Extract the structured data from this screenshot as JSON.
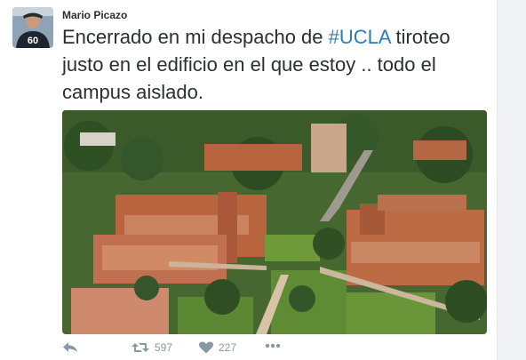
{
  "user": {
    "name": "Mario Picazo",
    "avatar_shirt_number": "60"
  },
  "tweet": {
    "text_before": "Encerrado en mi despacho de ",
    "hashtag": "#UCLA",
    "text_after": " tiroteo justo en el edificio en el que estoy .. todo el campus aislado."
  },
  "actions": {
    "reply_icon": "reply-icon",
    "retweet_icon": "retweet-icon",
    "retweet_count": "597",
    "like_icon": "heart-icon",
    "like_count": "227",
    "more_icon": "more-icon"
  },
  "colors": {
    "text": "#292f33",
    "link": "#2b7bb9",
    "muted": "#8899a6"
  }
}
